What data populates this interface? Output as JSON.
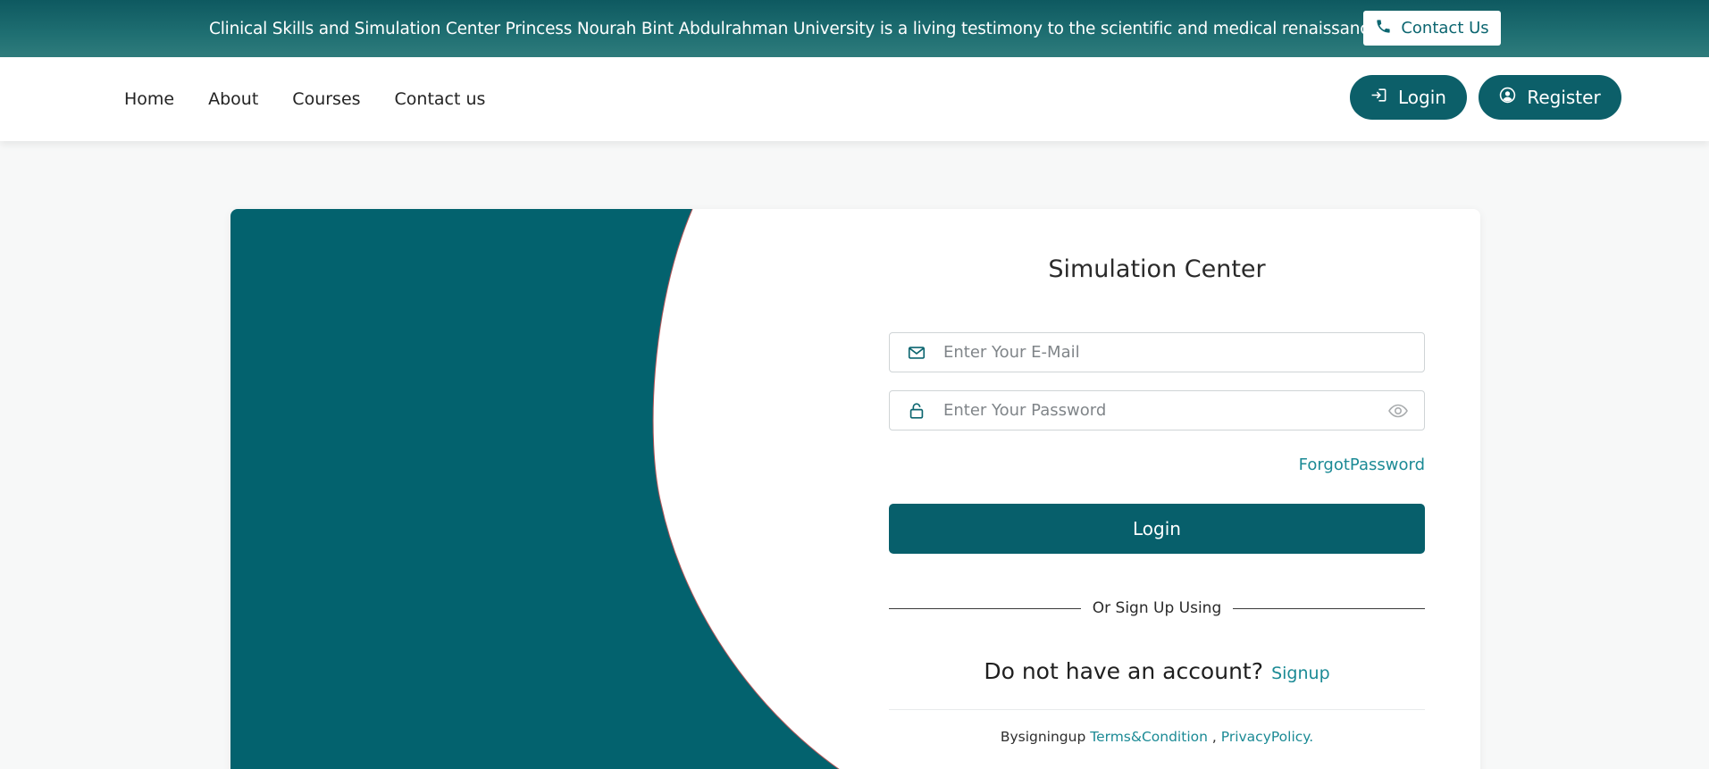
{
  "banner": {
    "text": "Clinical Skills and Simulation Center Princess Nourah Bint Abdulrahman University is a living testimony to the scientific and medical renaissance",
    "contact_label": "Contact Us"
  },
  "nav": {
    "links": [
      {
        "label": "Home"
      },
      {
        "label": "About"
      },
      {
        "label": "Courses"
      },
      {
        "label": "Contact us"
      }
    ],
    "login_label": "Login",
    "register_label": "Register"
  },
  "form": {
    "title": "Simulation Center",
    "email_placeholder": "Enter Your E-Mail",
    "password_placeholder": "Enter Your Password",
    "forgot_label": "ForgotPassword",
    "login_label": "Login",
    "divider_text": "Or Sign Up Using",
    "no_account_text": "Do not have an account?",
    "signup_label": "Signup",
    "terms_prefix": "Bysigningup",
    "terms_link": "Terms&Condition",
    "terms_sep": ",",
    "privacy_link": "PrivacyPolicy."
  },
  "colors": {
    "brand": "#0c5f69",
    "accent_link": "#1b8a95",
    "banner_bg": "#1f6f72"
  }
}
